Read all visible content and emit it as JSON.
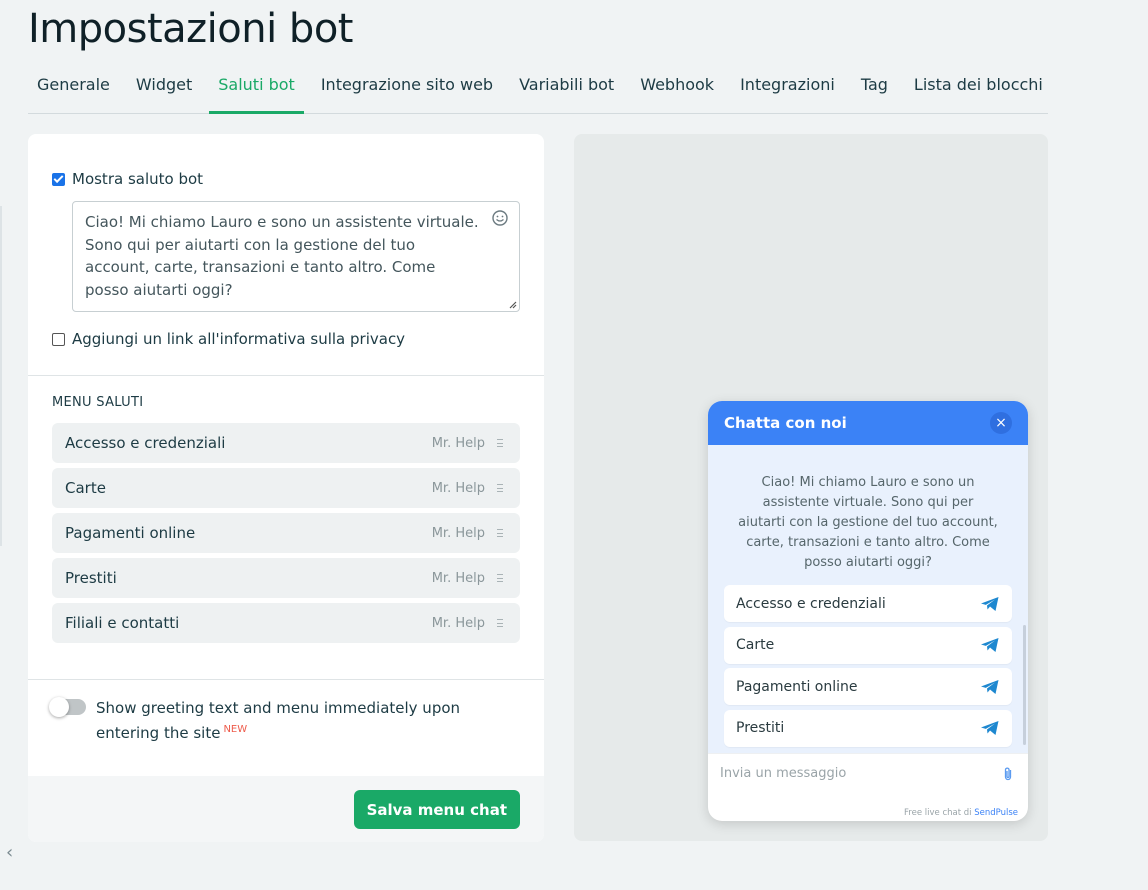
{
  "page": {
    "title": "Impostazioni bot"
  },
  "tabs": [
    {
      "label": "Generale"
    },
    {
      "label": "Widget"
    },
    {
      "label": "Saluti bot",
      "active": true
    },
    {
      "label": "Integrazione sito web"
    },
    {
      "label": "Variabili bot"
    },
    {
      "label": "Webhook"
    },
    {
      "label": "Integrazioni"
    },
    {
      "label": "Tag"
    },
    {
      "label": "Lista dei blocchi"
    }
  ],
  "settings": {
    "show_greeting_label": "Mostra saluto bot",
    "show_greeting_checked": true,
    "greeting_text": "Ciao! Mi chiamo Lauro e sono un assistente virtuale. Sono qui per aiutarti con la gestione del tuo account, carte, transazioni e tanto altro. Come posso aiutarti oggi?",
    "privacy_link_label": "Aggiungi un link all'informativa sulla privacy",
    "privacy_link_checked": false,
    "menu_section_label": "MENU SALUTI",
    "menu_items": [
      {
        "label": "Accesso e credenziali",
        "tag": "Mr. Help"
      },
      {
        "label": "Carte",
        "tag": "Mr. Help"
      },
      {
        "label": "Pagamenti online",
        "tag": "Mr. Help"
      },
      {
        "label": "Prestiti",
        "tag": "Mr. Help"
      },
      {
        "label": "Filiali e contatti",
        "tag": "Mr. Help"
      }
    ],
    "immediate_toggle_label": "Show greeting text and menu immediately upon entering the site",
    "immediate_toggle_on": false,
    "new_badge": "NEW",
    "save_button": "Salva menu chat"
  },
  "widget": {
    "title": "Chatta con noi",
    "close_icon": "×",
    "greeting": "Ciao! Mi chiamo Lauro e sono un assistente virtuale. Sono qui per aiutarti con la gestione del tuo account, carte, transazioni e tanto altro. Come posso aiutarti oggi?",
    "buttons": [
      {
        "label": "Accesso e credenziali"
      },
      {
        "label": "Carte"
      },
      {
        "label": "Pagamenti online"
      },
      {
        "label": "Prestiti"
      }
    ],
    "input_placeholder": "Invia un messaggio",
    "footer_prefix": "Free live chat di ",
    "footer_brand": "SendPulse"
  },
  "colors": {
    "accent_green": "#1aa967",
    "widget_blue": "#3b82f6",
    "send_icon_blue": "#1e88d0",
    "new_badge_red": "#ee5b4b"
  },
  "icons": {
    "emoji": "smiley-icon",
    "send": "telegram-send-icon",
    "attach": "paperclip-icon",
    "drag": "drag-handle-icon",
    "back": "chevron-left-icon"
  }
}
